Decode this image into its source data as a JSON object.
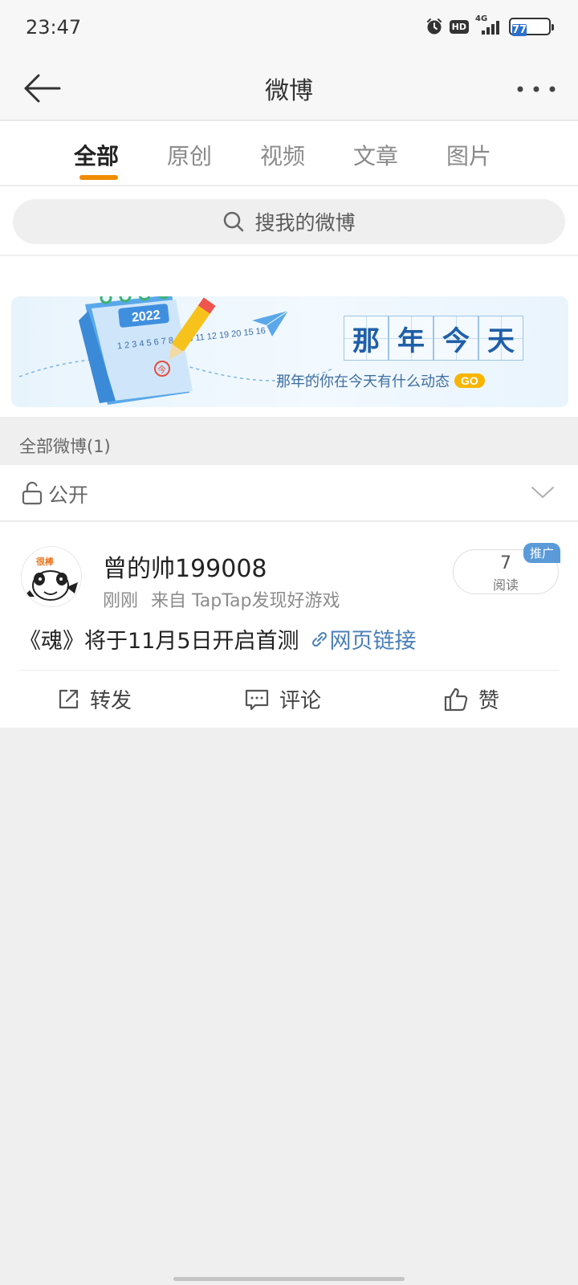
{
  "status_bar": {
    "time": "23:47",
    "network": "4G",
    "battery": "77",
    "hd_label": "HD",
    "icons": [
      "alarm-icon",
      "hd-icon",
      "signal-icon",
      "battery-icon"
    ]
  },
  "header": {
    "title": "微博",
    "back_icon": "back-arrow-icon",
    "more_icon": "more-dots-icon"
  },
  "tabs": [
    {
      "label": "全部",
      "active": true
    },
    {
      "label": "原创",
      "active": false
    },
    {
      "label": "视频",
      "active": false
    },
    {
      "label": "文章",
      "active": false
    },
    {
      "label": "图片",
      "active": false
    }
  ],
  "search": {
    "placeholder": "搜我的微博",
    "icon": "search-icon"
  },
  "banner": {
    "title_chars": [
      "那",
      "年",
      "今",
      "天"
    ],
    "subtitle": "那年的你在今天有什么动态",
    "go_label": "GO",
    "calendar_year": "2022",
    "calendar_today": "今",
    "calendar_numbers": "1 2 3 4 5 6 7  8 9 10 11 12  19 20  15 16"
  },
  "section_label": "全部微博(1)",
  "filter": {
    "label": "公开",
    "lock_icon": "unlock-icon",
    "chevron_icon": "chevron-down-icon"
  },
  "post": {
    "username": "曾的帅199008",
    "time": "刚刚",
    "source": "来自 TapTap发现好游戏",
    "avatar_caption": "很棒",
    "read_count": "7",
    "read_label": "阅读",
    "promo_tag": "推广",
    "body_text": "《魂》将于11月5日开启首测",
    "link_text": "网页链接",
    "actions": [
      {
        "label": "转发",
        "icon": "share-icon"
      },
      {
        "label": "评论",
        "icon": "comment-icon"
      },
      {
        "label": "赞",
        "icon": "like-icon"
      }
    ]
  },
  "colors": {
    "accent": "#f08c00",
    "link": "#4a7fb8",
    "promo": "#5a9ad8",
    "background": "#efefef"
  }
}
